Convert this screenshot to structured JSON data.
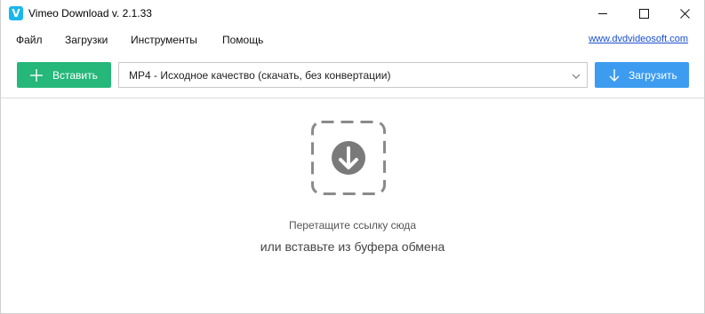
{
  "window": {
    "title": "Vimeo Download v. 2.1.33",
    "icon_letter": "V",
    "accent": "#1ab7ea"
  },
  "menu": {
    "items": [
      "Файл",
      "Загрузки",
      "Инструменты",
      "Помощь"
    ],
    "site_link": "www.dvdvideosoft.com"
  },
  "toolbar": {
    "paste_label": "Вставить",
    "format_value": "MP4 - Исходное качество (скачать, без конвертации)",
    "download_label": "Загрузить",
    "paste_color": "#26b77a",
    "download_color": "#3d9cf0"
  },
  "dropzone": {
    "icon": "download-arrow-icon",
    "hint_primary": "Перетащите ссылку сюда",
    "hint_secondary": "или вставьте из буфера обмена"
  }
}
